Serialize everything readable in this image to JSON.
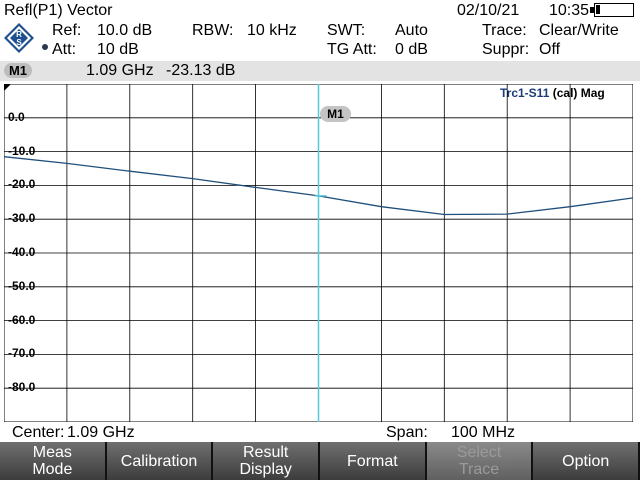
{
  "header": {
    "title": "Refl(P1) Vector",
    "date": "02/10/21",
    "time": "10:35",
    "ref_label": "Ref:",
    "ref_value": "10.0 dB",
    "att_label": "Att:",
    "att_value": "10 dB",
    "rbw_label": "RBW:",
    "rbw_value": "10 kHz",
    "swt_label": "SWT:",
    "swt_value": "Auto",
    "tgatt_label": "TG Att:",
    "tgatt_value": "0 dB",
    "trace_label": "Trace:",
    "trace_value": "Clear/Write",
    "suppr_label": "Suppr:",
    "suppr_value": "Off"
  },
  "marker": {
    "name": "M1",
    "freq": "1.09 GHz",
    "level": "-23.13 dB"
  },
  "plot": {
    "trace_name": "Trc1-S11",
    "trace_suffix": "(cal) Mag",
    "marker_label": "M1",
    "y_ticks": [
      "0.0",
      "-10.0",
      "-20.0",
      "-30.0",
      "-40.0",
      "-50.0",
      "-60.0",
      "-70.0",
      "-80.0"
    ],
    "trace_color": "#1f4f7a",
    "marker_line_color": "#56c8d8"
  },
  "footer": {
    "center_label": "Center:",
    "center_value": "1.09 GHz",
    "span_label": "Span:",
    "span_value": "100 MHz"
  },
  "softkeys": [
    {
      "line1": "Meas",
      "line2": "Mode",
      "enabled": true
    },
    {
      "line1": "Calibration",
      "line2": "",
      "enabled": true
    },
    {
      "line1": "Result",
      "line2": "Display",
      "enabled": true
    },
    {
      "line1": "Format",
      "line2": "",
      "enabled": true
    },
    {
      "line1": "Select",
      "line2": "Trace",
      "enabled": false
    },
    {
      "line1": "Option",
      "line2": "",
      "enabled": true
    }
  ],
  "chart_data": {
    "type": "line",
    "title": "",
    "xlabel": "",
    "ylabel": "",
    "xlim": [
      1.04,
      1.14
    ],
    "ylim": [
      -90,
      10
    ],
    "grid": true,
    "series": [
      {
        "name": "Trc1-S11",
        "x": [
          1.04,
          1.05,
          1.06,
          1.07,
          1.08,
          1.09,
          1.1,
          1.11,
          1.12,
          1.13,
          1.14
        ],
        "values": [
          -11.5,
          -13.5,
          -15.8,
          -18.0,
          -20.6,
          -23.1,
          -26.3,
          -28.6,
          -28.5,
          -26.3,
          -23.7
        ]
      }
    ],
    "marker_x": 1.09
  }
}
